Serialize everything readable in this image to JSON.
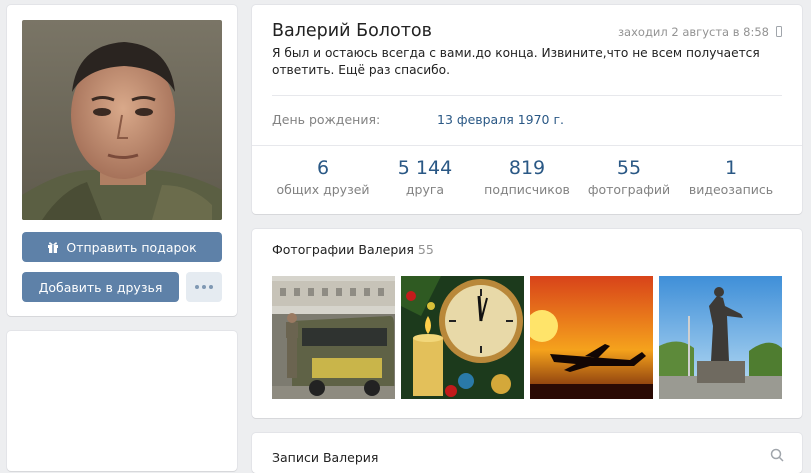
{
  "profile": {
    "name": "Валерий Болотов",
    "last_seen": "заходил 2 августа в 8:58",
    "status": "Я был и остаюсь всегда с вами.до конца. Извините,что не всем получается ответить. Ещё раз спасибо.",
    "birthday_label": "День рождения:",
    "birthday_value": "13 февраля 1970 г."
  },
  "actions": {
    "gift_label": "Отправить подарок",
    "add_friend_label": "Добавить в друзья"
  },
  "counters": [
    {
      "value": "6",
      "label": "общих друзей"
    },
    {
      "value": "5 144",
      "label": "друга"
    },
    {
      "value": "819",
      "label": "подписчиков"
    },
    {
      "value": "55",
      "label": "фотографий"
    },
    {
      "value": "1",
      "label": "видеозапись"
    }
  ],
  "photos": {
    "title": "Фотографии Валерия",
    "count": "55"
  },
  "wall": {
    "title": "Записи Валерия"
  },
  "colors": {
    "accent": "#5e81a8",
    "link": "#2a5885",
    "background": "#edeef0"
  },
  "icons": [
    "gift-icon",
    "more-dots-icon",
    "mobile-phone-icon",
    "search-icon"
  ]
}
